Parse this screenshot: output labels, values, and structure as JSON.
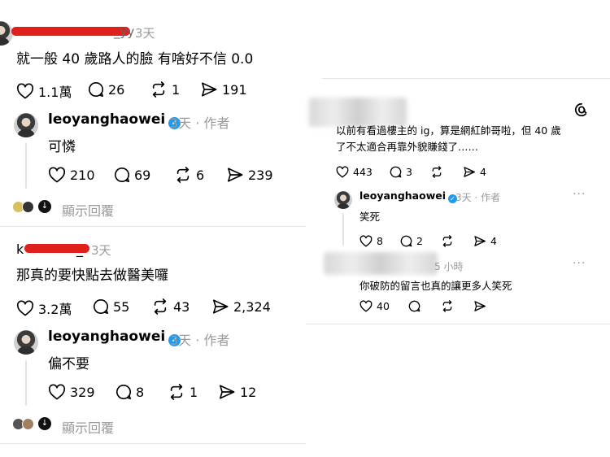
{
  "left": {
    "post1": {
      "handle_visible": "_yy",
      "time": "3天",
      "text": "就一般 40 歲路人的臉 有啥好不信 0.0",
      "likes": "1.1萬",
      "comments": "26",
      "reposts": "1",
      "shares": "191"
    },
    "reply1": {
      "username": "leoyanghaowei",
      "time": "3天",
      "dot": "·",
      "author_tag": "作者",
      "text": "可憐",
      "likes": "210",
      "comments": "69",
      "reposts": "6",
      "shares": "239",
      "show_replies": "顯示回覆"
    },
    "post2": {
      "handle_start": "k",
      "handle_end": "_",
      "time": "3天",
      "text": "那真的要快點去做醫美囉",
      "likes": "3.2萬",
      "comments": "55",
      "reposts": "43",
      "shares": "2,324"
    },
    "reply2": {
      "username": "leoyanghaowei",
      "time": "3天",
      "dot": "·",
      "author_tag": "作者",
      "text": "偏不要",
      "likes": "329",
      "comments": "8",
      "reposts": "1",
      "shares": "12",
      "show_replies": "顯示回覆"
    }
  },
  "right": {
    "post1": {
      "text_line1": "以前有看過樓主的 ig，算是網紅帥哥啦，但 40 歲",
      "text_line2": "了不太適合再靠外貌賺錢了……",
      "likes": "443",
      "comments": "3",
      "shares": "4"
    },
    "reply1": {
      "username": "leoyanghaowei",
      "time": "3天",
      "dot": "·",
      "author_tag": "作者",
      "text": "笑死",
      "likes": "8",
      "comments": "2",
      "shares": "4",
      "more": "···"
    },
    "reply2": {
      "time": "5 小時",
      "text": "你破防的留言也真的讓更多人笑死",
      "likes": "40",
      "more": "···"
    }
  },
  "icons": {
    "like": "heart-icon",
    "comment": "comment-bubble-icon",
    "repost": "repost-icon",
    "share": "share-arrow-icon",
    "threads": "threads-logo-icon",
    "verified": "verified-badge-icon"
  },
  "colors": {
    "verified": "#1d9bf0",
    "secondary_text": "#9a9a9a",
    "redaction": "#e0201a"
  }
}
